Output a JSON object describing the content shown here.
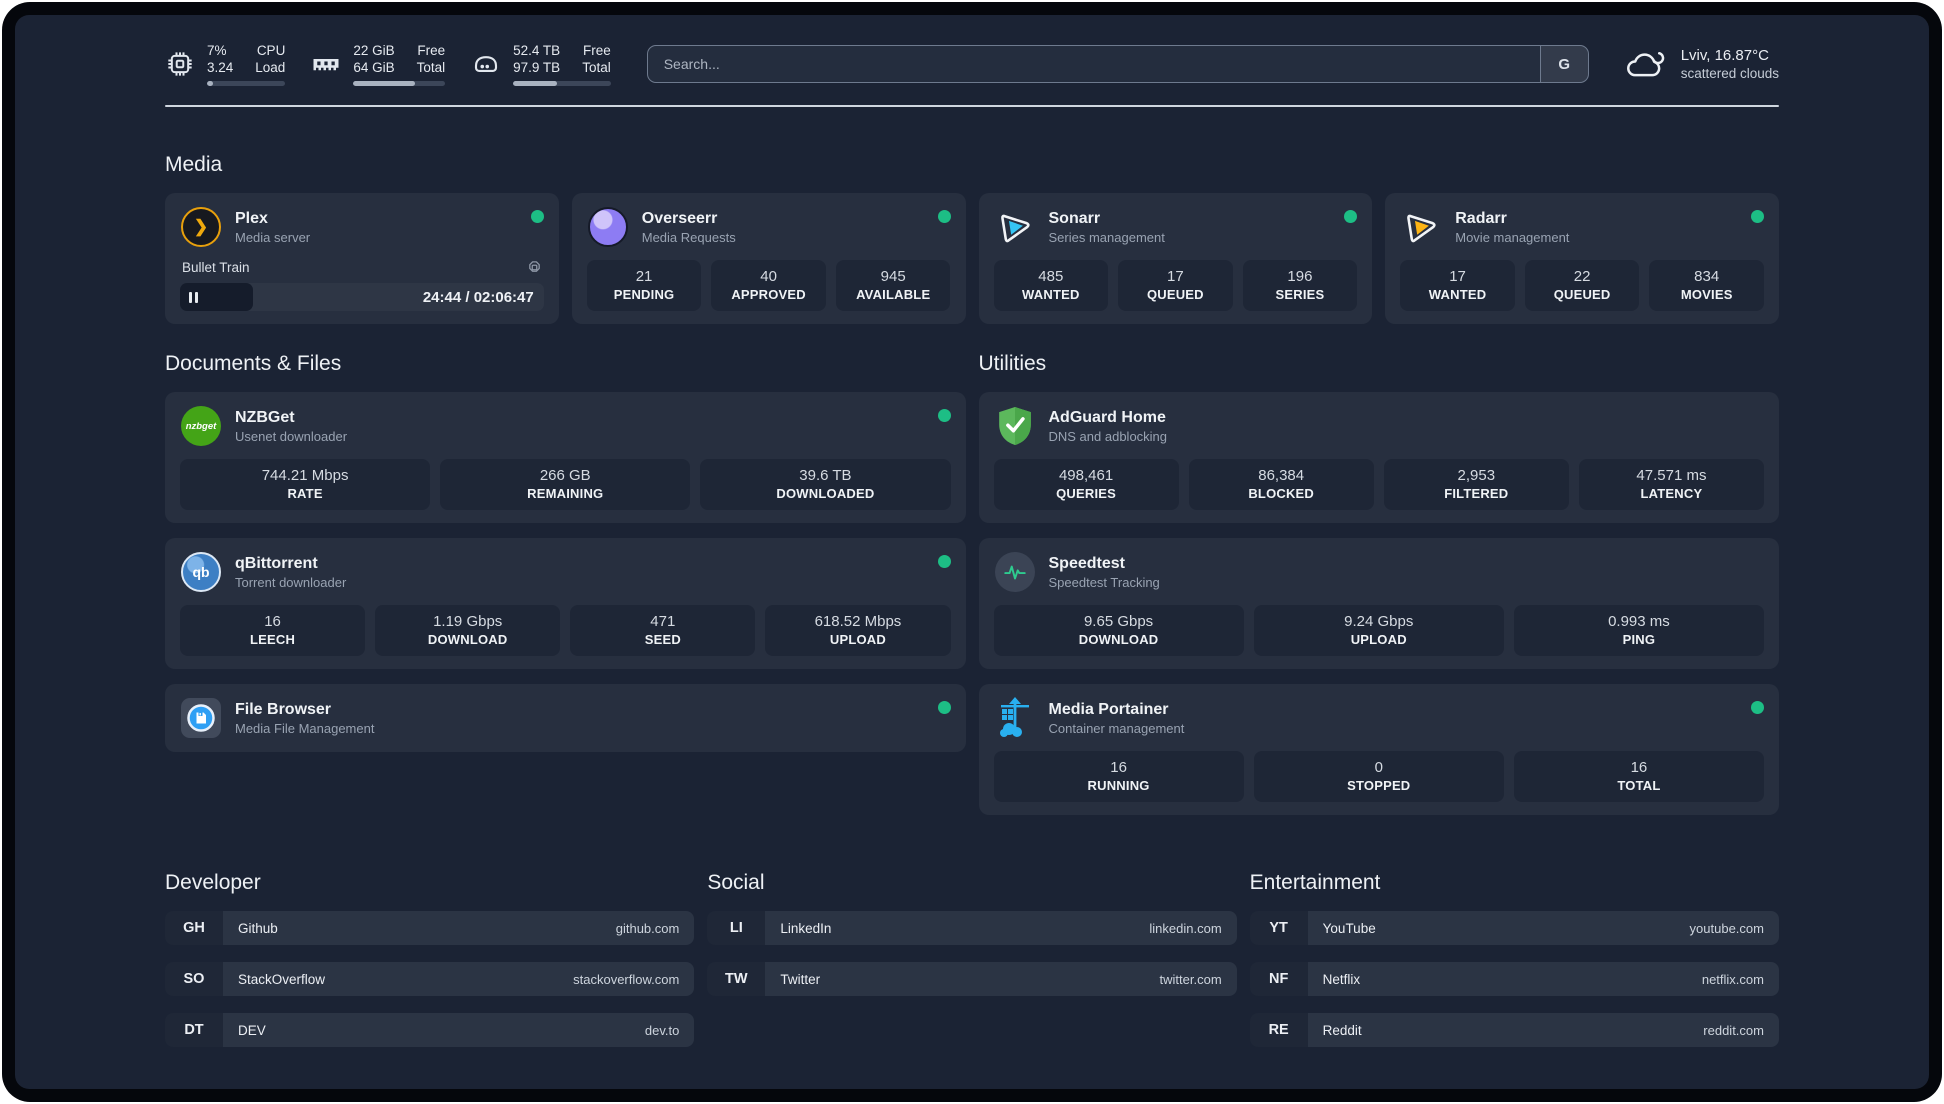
{
  "system": {
    "cpu": {
      "value_top": "7%",
      "value_bottom": "3.24",
      "label_top": "CPU",
      "label_bottom": "Load",
      "progress_percent": 8
    },
    "memory": {
      "value_top": "22 GiB",
      "value_bottom": "64 GiB",
      "label_top": "Free",
      "label_bottom": "Total",
      "progress_percent": 67
    },
    "storage": {
      "value_top": "52.4 TB",
      "value_bottom": "97.9 TB",
      "label_top": "Free",
      "label_bottom": "Total",
      "progress_percent": 45
    }
  },
  "search": {
    "placeholder": "Search...",
    "engine_button": "G"
  },
  "weather": {
    "location": "Lviv, 16.87°C",
    "condition": "scattered clouds"
  },
  "colors": {
    "status_online": "#1dbe85",
    "page_bg": "#1b2334",
    "card_bg": "#272f3f",
    "stat_bg": "#1e2636"
  },
  "media": {
    "title": "Media",
    "plex": {
      "title": "Plex",
      "subtitle": "Media server",
      "session": {
        "name": "Bullet Train",
        "time": "24:44 / 02:06:47",
        "progress_percent": 20
      }
    },
    "overseerr": {
      "title": "Overseerr",
      "subtitle": "Media Requests",
      "stats": [
        {
          "value": "21",
          "label": "PENDING"
        },
        {
          "value": "40",
          "label": "APPROVED"
        },
        {
          "value": "945",
          "label": "AVAILABLE"
        }
      ]
    },
    "sonarr": {
      "title": "Sonarr",
      "subtitle": "Series management",
      "stats": [
        {
          "value": "485",
          "label": "WANTED"
        },
        {
          "value": "17",
          "label": "QUEUED"
        },
        {
          "value": "196",
          "label": "SERIES"
        }
      ]
    },
    "radarr": {
      "title": "Radarr",
      "subtitle": "Movie management",
      "stats": [
        {
          "value": "17",
          "label": "WANTED"
        },
        {
          "value": "22",
          "label": "QUEUED"
        },
        {
          "value": "834",
          "label": "MOVIES"
        }
      ]
    }
  },
  "documents": {
    "title": "Documents & Files",
    "nzbget": {
      "title": "NZBGet",
      "subtitle": "Usenet downloader",
      "icon_text": "nzbget",
      "stats": [
        {
          "value": "744.21 Mbps",
          "label": "RATE"
        },
        {
          "value": "266 GB",
          "label": "REMAINING"
        },
        {
          "value": "39.6 TB",
          "label": "DOWNLOADED"
        }
      ]
    },
    "qbittorrent": {
      "title": "qBittorrent",
      "subtitle": "Torrent downloader",
      "icon_text": "qb",
      "stats": [
        {
          "value": "16",
          "label": "LEECH"
        },
        {
          "value": "1.19 Gbps",
          "label": "DOWNLOAD"
        },
        {
          "value": "471",
          "label": "SEED"
        },
        {
          "value": "618.52 Mbps",
          "label": "UPLOAD"
        }
      ]
    },
    "filebrowser": {
      "title": "File Browser",
      "subtitle": "Media File Management"
    }
  },
  "utilities": {
    "title": "Utilities",
    "adguard": {
      "title": "AdGuard Home",
      "subtitle": "DNS and adblocking",
      "stats": [
        {
          "value": "498,461",
          "label": "QUERIES"
        },
        {
          "value": "86,384",
          "label": "BLOCKED"
        },
        {
          "value": "2,953",
          "label": "FILTERED"
        },
        {
          "value": "47.571 ms",
          "label": "LATENCY"
        }
      ]
    },
    "speedtest": {
      "title": "Speedtest",
      "subtitle": "Speedtest Tracking",
      "stats": [
        {
          "value": "9.65 Gbps",
          "label": "DOWNLOAD"
        },
        {
          "value": "9.24 Gbps",
          "label": "UPLOAD"
        },
        {
          "value": "0.993 ms",
          "label": "PING"
        }
      ]
    },
    "portainer": {
      "title": "Media Portainer",
      "subtitle": "Container management",
      "stats": [
        {
          "value": "16",
          "label": "RUNNING"
        },
        {
          "value": "0",
          "label": "STOPPED"
        },
        {
          "value": "16",
          "label": "TOTAL"
        }
      ]
    }
  },
  "bookmarks": {
    "developer": {
      "title": "Developer",
      "links": [
        {
          "abbr": "GH",
          "name": "Github",
          "url": "github.com"
        },
        {
          "abbr": "SO",
          "name": "StackOverflow",
          "url": "stackoverflow.com"
        },
        {
          "abbr": "DT",
          "name": "DEV",
          "url": "dev.to"
        }
      ]
    },
    "social": {
      "title": "Social",
      "links": [
        {
          "abbr": "LI",
          "name": "LinkedIn",
          "url": "linkedin.com"
        },
        {
          "abbr": "TW",
          "name": "Twitter",
          "url": "twitter.com"
        }
      ]
    },
    "entertainment": {
      "title": "Entertainment",
      "links": [
        {
          "abbr": "YT",
          "name": "YouTube",
          "url": "youtube.com"
        },
        {
          "abbr": "NF",
          "name": "Netflix",
          "url": "netflix.com"
        },
        {
          "abbr": "RE",
          "name": "Reddit",
          "url": "reddit.com"
        }
      ]
    }
  }
}
